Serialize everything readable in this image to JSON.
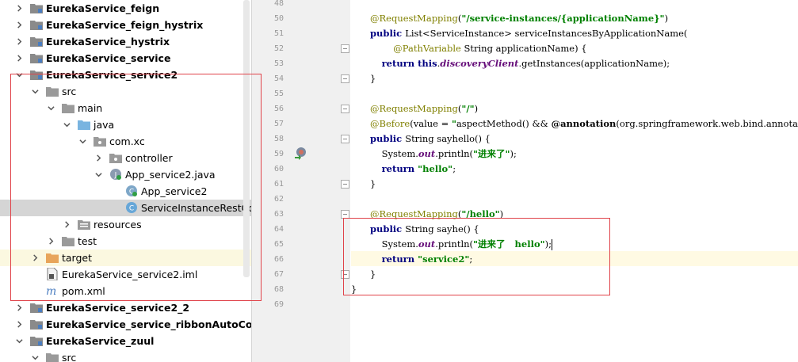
{
  "tree": {
    "items": [
      {
        "label": "EurekaService_feign",
        "bold": true,
        "level": 0,
        "expanded": false,
        "icon": "module-folder-icon"
      },
      {
        "label": "EurekaService_feign_hystrix",
        "bold": true,
        "level": 0,
        "expanded": false,
        "icon": "module-folder-icon"
      },
      {
        "label": "EurekaService_hystrix",
        "bold": true,
        "level": 0,
        "expanded": false,
        "icon": "module-folder-icon"
      },
      {
        "label": "EurekaService_service",
        "bold": true,
        "level": 0,
        "expanded": false,
        "icon": "module-folder-icon"
      },
      {
        "label": "EurekaService_service2",
        "bold": true,
        "level": 0,
        "expanded": true,
        "icon": "module-folder-icon"
      },
      {
        "label": "src",
        "bold": false,
        "level": 1,
        "expanded": true,
        "icon": "folder-icon"
      },
      {
        "label": "main",
        "bold": false,
        "level": 2,
        "expanded": true,
        "icon": "folder-icon"
      },
      {
        "label": "java",
        "bold": false,
        "level": 3,
        "expanded": true,
        "icon": "source-folder-icon"
      },
      {
        "label": "com.xc",
        "bold": false,
        "level": 4,
        "expanded": true,
        "icon": "package-icon"
      },
      {
        "label": "controller",
        "bold": false,
        "level": 5,
        "expanded": false,
        "icon": "package-icon"
      },
      {
        "label": "App_service2.java",
        "bold": false,
        "level": 5,
        "expanded": true,
        "icon": "java-file-icon"
      },
      {
        "label": "App_service2",
        "bold": false,
        "level": 6,
        "expanded": null,
        "icon": "spring-boot-class-icon"
      },
      {
        "label": "ServiceInstanceRestController",
        "bold": false,
        "level": 6,
        "expanded": null,
        "icon": "class-icon",
        "selected": true
      },
      {
        "label": "resources",
        "bold": false,
        "level": 3,
        "expanded": false,
        "icon": "resources-folder-icon"
      },
      {
        "label": "test",
        "bold": false,
        "level": 2,
        "expanded": false,
        "icon": "folder-icon"
      },
      {
        "label": "target",
        "bold": false,
        "level": 1,
        "expanded": false,
        "icon": "excluded-folder-icon",
        "excluded": true
      },
      {
        "label": "EurekaService_service2.iml",
        "bold": false,
        "level": 1,
        "expanded": null,
        "icon": "iml-file-icon"
      },
      {
        "label": "pom.xml",
        "bold": false,
        "level": 1,
        "expanded": null,
        "icon": "maven-icon"
      },
      {
        "label": "EurekaService_service2_2",
        "bold": true,
        "level": 0,
        "expanded": false,
        "icon": "module-folder-icon"
      },
      {
        "label": "EurekaService_service_ribbonAutoConfig",
        "bold": true,
        "level": 0,
        "expanded": false,
        "icon": "module-folder-icon"
      },
      {
        "label": "EurekaService_zuul",
        "bold": true,
        "level": 0,
        "expanded": true,
        "icon": "module-folder-icon"
      },
      {
        "label": "src",
        "bold": false,
        "level": 1,
        "expanded": true,
        "icon": "folder-icon"
      }
    ]
  },
  "editor": {
    "line_numbers": [
      "48",
      "50",
      "51",
      "52",
      "53",
      "54",
      "55",
      "56",
      "57",
      "58",
      "59",
      "60",
      "61",
      "62",
      "63",
      "64",
      "65",
      "66",
      "67",
      "68",
      "69"
    ],
    "lines": [
      [],
      [
        {
          "t": "@RequestMapping",
          "c": "ann"
        },
        {
          "t": "(",
          "c": ""
        },
        {
          "t": "\"/service-instances/{applicationName}\"",
          "c": "str"
        },
        {
          "t": ")",
          "c": ""
        }
      ],
      [
        {
          "t": "public ",
          "c": "kw"
        },
        {
          "t": "List<ServiceInstance> serviceInstancesByApplicationName(",
          "c": ""
        }
      ],
      [
        {
          "t": "        ",
          "c": ""
        },
        {
          "t": "@PathVariable ",
          "c": "ann"
        },
        {
          "t": "String applicationName) {",
          "c": ""
        }
      ],
      [
        {
          "t": "    ",
          "c": ""
        },
        {
          "t": "return this",
          "c": "kw"
        },
        {
          "t": ".",
          "c": ""
        },
        {
          "t": "discoveryClient",
          "c": "field"
        },
        {
          "t": ".getInstances(applicationName);",
          "c": ""
        }
      ],
      [
        {
          "t": "}",
          "c": ""
        }
      ],
      [],
      [
        {
          "t": "@RequestMapping",
          "c": "ann"
        },
        {
          "t": "(",
          "c": ""
        },
        {
          "t": "\"/\"",
          "c": "str"
        },
        {
          "t": ")",
          "c": ""
        }
      ],
      [
        {
          "t": "@Before",
          "c": "ann"
        },
        {
          "t": "(value = ",
          "c": ""
        },
        {
          "t": "\"",
          "c": "str"
        },
        {
          "t": "aspectMethod() && ",
          "c": ""
        },
        {
          "t": "@annotation",
          "c": "annkw"
        },
        {
          "t": "(org.springframework.web.bind.annotation.R",
          "c": ""
        }
      ],
      [
        {
          "t": "public ",
          "c": "kw"
        },
        {
          "t": "String ",
          "c": ""
        },
        {
          "t": "sayhello",
          "c": ""
        },
        {
          "t": "() {",
          "c": ""
        }
      ],
      [
        {
          "t": "    System.",
          "c": ""
        },
        {
          "t": "out",
          "c": "field"
        },
        {
          "t": ".println(",
          "c": ""
        },
        {
          "t": "\"进来了\"",
          "c": "str"
        },
        {
          "t": ");",
          "c": ""
        }
      ],
      [
        {
          "t": "    ",
          "c": ""
        },
        {
          "t": "return ",
          "c": "kw"
        },
        {
          "t": "\"hello\"",
          "c": "str"
        },
        {
          "t": ";",
          "c": ""
        }
      ],
      [
        {
          "t": "}",
          "c": ""
        }
      ],
      [],
      [
        {
          "t": "@RequestMapping",
          "c": "ann"
        },
        {
          "t": "(",
          "c": ""
        },
        {
          "t": "\"/hello\"",
          "c": "str"
        },
        {
          "t": ")",
          "c": ""
        }
      ],
      [
        {
          "t": "public ",
          "c": "kw"
        },
        {
          "t": "String ",
          "c": ""
        },
        {
          "t": "sayhe",
          "c": ""
        },
        {
          "t": "() {",
          "c": ""
        }
      ],
      [
        {
          "t": "    System.",
          "c": ""
        },
        {
          "t": "out",
          "c": "field"
        },
        {
          "t": ".println(",
          "c": ""
        },
        {
          "t": "\"进来了   hello\"",
          "c": "str"
        },
        {
          "t": ");",
          "c": ""
        }
      ],
      [
        {
          "t": "    ",
          "c": ""
        },
        {
          "t": "return ",
          "c": "kw"
        },
        {
          "t": "\"service2\"",
          "c": "str"
        },
        {
          "t": ";",
          "c": ""
        }
      ],
      [
        {
          "t": "}",
          "c": ""
        }
      ],
      [
        {
          "t": "}",
          "c": ""
        }
      ],
      []
    ]
  },
  "colors": {
    "annotation": "#808000",
    "keyword": "#000080",
    "string": "#008000",
    "field": "#660e7a",
    "highlight_box": "#e0434a",
    "current_line": "#fffae3",
    "selected_row": "#d5d5d5"
  }
}
